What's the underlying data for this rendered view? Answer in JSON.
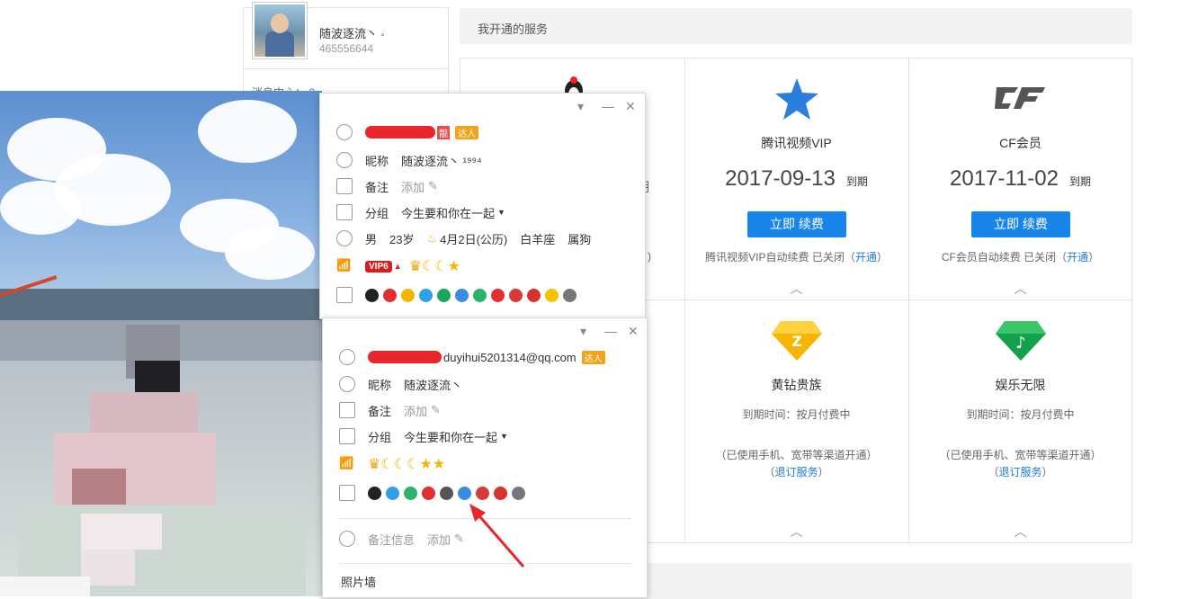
{
  "profile": {
    "name": "随波逐流丶",
    "name_mark": "▫",
    "qq": "465556644",
    "msg_center_label": "消息中心：",
    "msg_center_count": "0"
  },
  "services": {
    "title": "我开通的服务",
    "top": [
      {
        "name": "",
        "date_suffix": "期",
        "note_suffix": ")"
      },
      {
        "name": "腾讯视频VIP",
        "date": "2017-09-13",
        "date_suffix": "到期",
        "button": "立即 续费",
        "note": "腾讯视频VIP自动续费 已关闭（",
        "note_link": "开通",
        "note_end": "）"
      },
      {
        "name": "CF会员",
        "date": "2017-11-02",
        "date_suffix": "到期",
        "button": "立即 续费",
        "note": "CF会员自动续费 已关闭（",
        "note_link": "开通",
        "note_end": "）"
      }
    ],
    "bottom": [
      {
        "name": "黄钻贵族",
        "expire": "到期时间：按月付费中",
        "note": "（已使用手机、宽带等渠道开通）",
        "link": "（",
        "link_text": "退订服务",
        "link_end": "）"
      },
      {
        "name": "娱乐无限",
        "expire": "到期时间：按月付费中",
        "note": "（已使用手机、宽带等渠道开通）",
        "link": "（",
        "link_text": "退订服务",
        "link_end": "）"
      }
    ],
    "caret": "︿"
  },
  "popup1": {
    "hd_badge": "靓",
    "dr_badge": "达人",
    "nickname_label": "昵称",
    "nickname": "随波逐流丶 ¹⁹⁹⁴",
    "remark_label": "备注",
    "remark_value": "添加",
    "group_label": "分组",
    "group_value": "今生要和你在一起",
    "gender": "男",
    "age": "23岁",
    "birthday": "4月2日(公历)",
    "zodiac": "白羊座",
    "animal": "属狗",
    "vip": "VIP6",
    "win_controls": [
      "▾",
      "—",
      "✕"
    ]
  },
  "popup2": {
    "email": "duyihui5201314@qq.com",
    "dr_badge": "达人",
    "nickname_label": "昵称",
    "nickname": "随波逐流丶",
    "remark_label": "备注",
    "remark_value": "添加",
    "group_label": "分组",
    "group_value": "今生要和你在一起",
    "remark_info_label": "备注信息",
    "remark_info_value": "添加",
    "photo_wall": "照片墙",
    "win_controls": [
      "▾",
      "—",
      "✕"
    ]
  },
  "colors": {
    "accent_blue": "#1a85e8",
    "redaction": "#e8262b",
    "arrow": "#e8262b"
  }
}
